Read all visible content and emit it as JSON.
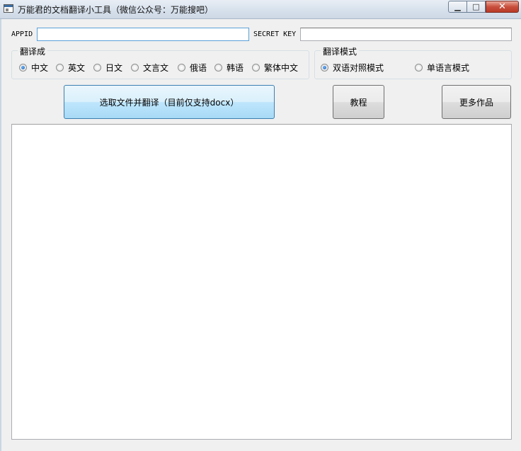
{
  "window": {
    "title": "万能君的文档翻译小工具（微信公众号：万能搜吧）",
    "minimize_glyph": "▁",
    "maximize_glyph": "□",
    "close_glyph": "✕"
  },
  "credentials": {
    "appid_label": "APPID",
    "appid_value": "",
    "secret_label": "SECRET KEY",
    "secret_value": ""
  },
  "target_language": {
    "legend": "翻译成",
    "selected": "中文",
    "options": [
      "中文",
      "英文",
      "日文",
      "文言文",
      "俄语",
      "韩语",
      "繁体中文"
    ]
  },
  "translate_mode": {
    "legend": "翻译模式",
    "selected": "双语对照模式",
    "options": [
      "双语对照模式",
      "单语言模式"
    ]
  },
  "buttons": {
    "select_translate": "选取文件并翻译（目前仅支持docx）",
    "tutorial": "教程",
    "more_works": "更多作品"
  },
  "output": {
    "text": ""
  },
  "colors": {
    "window_bg": "#f0f0f0",
    "primary_button": "#bee6fd",
    "close_button": "#c9503d"
  }
}
